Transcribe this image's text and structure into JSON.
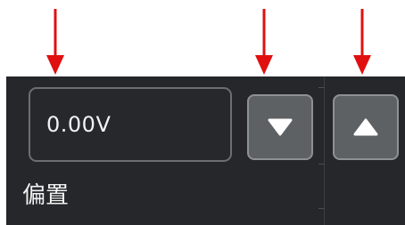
{
  "offset_control": {
    "value": "0.00V",
    "label": "偏置",
    "decrease_icon": "triangle-down-icon",
    "increase_icon": "triangle-up-icon"
  },
  "colors": {
    "annotation_arrow": "#e01010",
    "panel_background": "#25272a",
    "button_background": "#5e6164",
    "text": "#f2f2f2"
  }
}
